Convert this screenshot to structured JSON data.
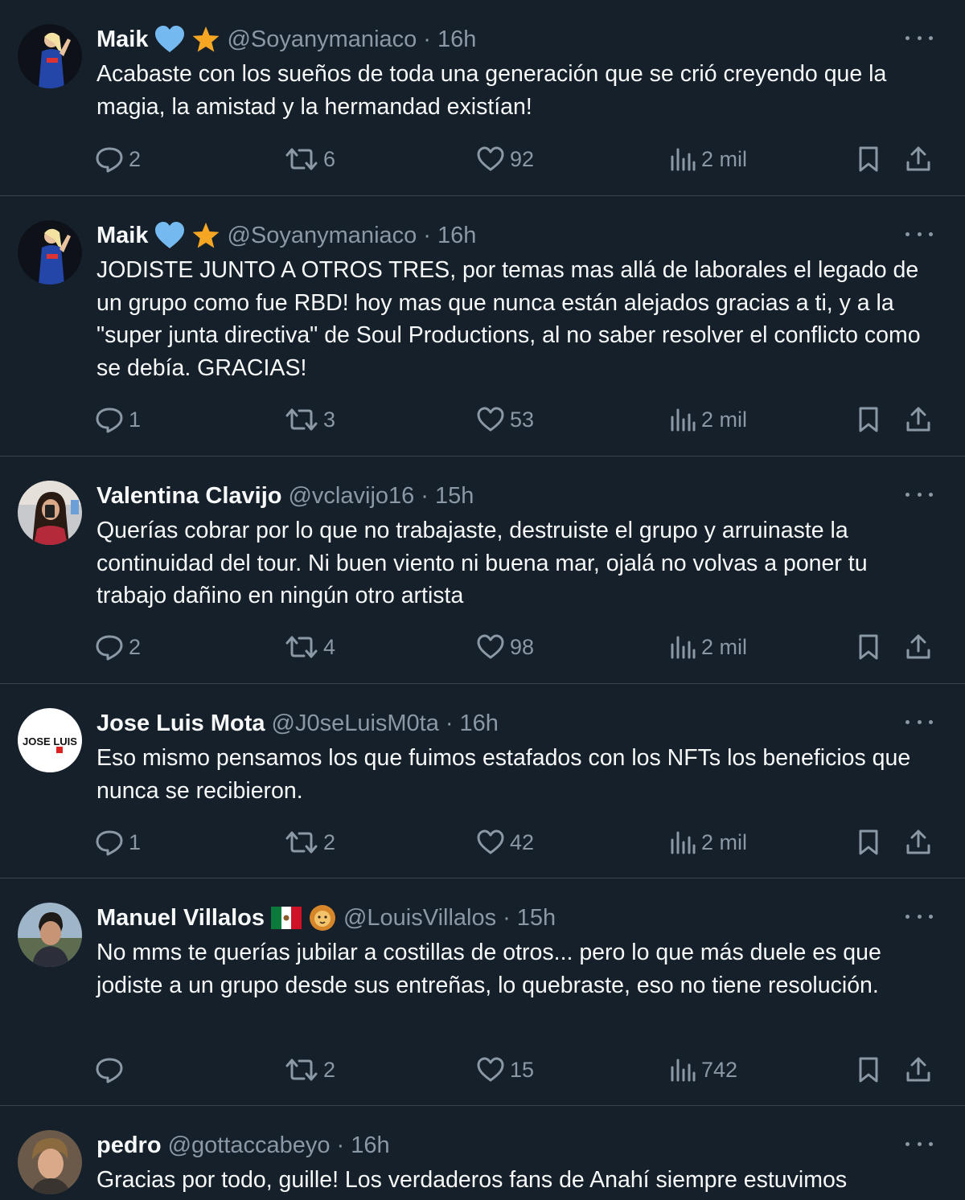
{
  "tweets": [
    {
      "name": "Maik",
      "badges": [
        "blue-heart-icon",
        "star-icon"
      ],
      "handle": "@Soyanymaniaco",
      "time": "16h",
      "text": "Acabaste con los sueños de toda una generación que se crió creyendo que la magia, la amistad y la hermandad existían!",
      "replies": "2",
      "retweets": "6",
      "likes": "92",
      "views": "2 mil"
    },
    {
      "name": "Maik",
      "badges": [
        "blue-heart-icon",
        "star-icon"
      ],
      "handle": "@Soyanymaniaco",
      "time": "16h",
      "text": "JODISTE JUNTO A OTROS TRES, por temas mas allá de laborales el legado de un grupo como fue RBD! hoy mas que nunca están alejados gracias a ti, y a la \"super junta directiva\" de Soul Productions, al no saber resolver el conflicto como se debía. GRACIAS!",
      "replies": "1",
      "retweets": "3",
      "likes": "53",
      "views": "2 mil"
    },
    {
      "name": "Valentina Clavijo",
      "badges": [],
      "handle": "@vclavijo16",
      "time": "15h",
      "text": "Querías cobrar por lo que no trabajaste, destruiste el grupo y arruinaste la continuidad del tour. Ni buen viento ni buena mar, ojalá no volvas a poner tu trabajo dañino en ningún otro artista",
      "replies": "2",
      "retweets": "4",
      "likes": "98",
      "views": "2 mil"
    },
    {
      "name": "Jose Luis Mota",
      "badges": [],
      "handle": "@J0seLuisM0ta",
      "time": "16h",
      "text": "Eso mismo pensamos los que fuimos estafados con los NFTs los beneficios que nunca se recibieron.",
      "replies": "1",
      "retweets": "2",
      "likes": "42",
      "views": "2 mil"
    },
    {
      "name": "Manuel Villalos",
      "badges": [
        "mexico-flag-icon",
        "lion-icon"
      ],
      "handle": "@LouisVillalos",
      "time": "15h",
      "text": "No mms te querías jubilar a costillas de otros... pero lo que más duele es que jodiste a un grupo desde sus entreñas, lo quebraste, eso no tiene resolución.",
      "replies": "",
      "retweets": "2",
      "likes": "15",
      "views": "742"
    },
    {
      "name": "pedro",
      "badges": [],
      "handle": "@gottaccabeyo",
      "time": "16h",
      "text": "Gracias por todo, guille! Los verdaderos fans de Anahí siempre estuvimos",
      "replies": "",
      "retweets": "",
      "likes": "",
      "views": ""
    }
  ],
  "avatar_labels": {
    "jose": "JOSE LUIS"
  },
  "separator": "·",
  "colors": {
    "background": "#15202b",
    "text": "#f7f9f9",
    "muted": "#8b98a5",
    "divider": "#38444d"
  }
}
